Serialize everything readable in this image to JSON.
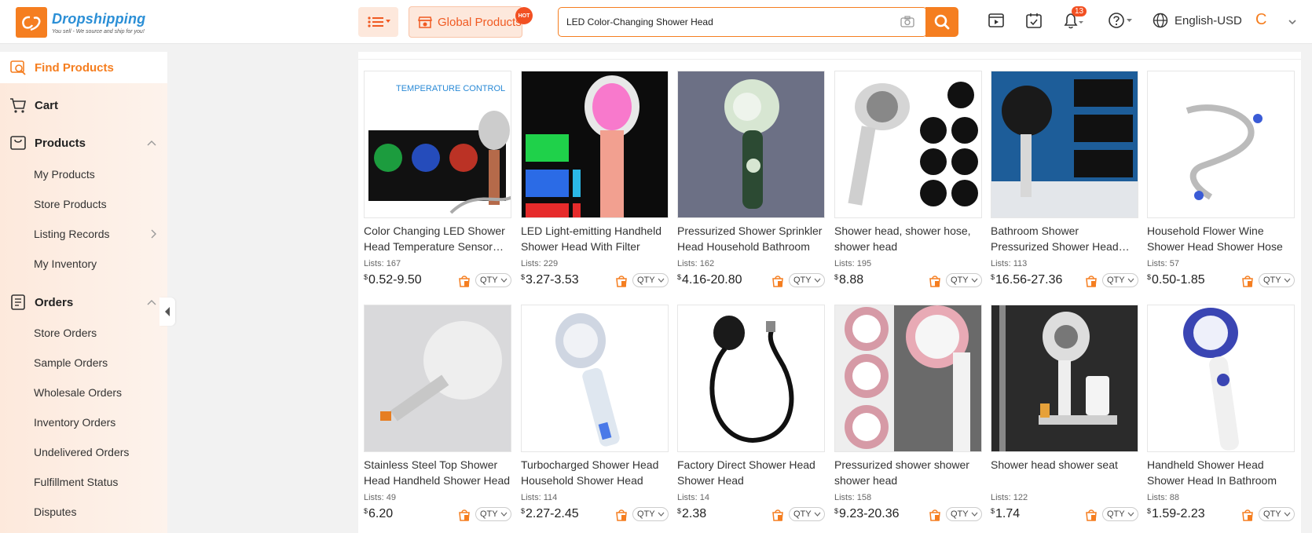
{
  "header": {
    "logo_title": "Dropshipping",
    "logo_sub": "You sell - We source and ship for you!",
    "global_label": "Global Products",
    "hot_badge": "HOT",
    "search_value": "LED Color-Changing Shower Head",
    "notification_count": "13",
    "language": "English-USD",
    "avatar_initial": "C"
  },
  "colors": {
    "accent": "#f57e20",
    "link": "#2b8fd6",
    "badge": "#f25022"
  },
  "sidebar": {
    "find_products": "Find Products",
    "cart": "Cart",
    "products": "Products",
    "products_items": [
      "My Products",
      "Store Products",
      "Listing Records",
      "My Inventory"
    ],
    "orders": "Orders",
    "orders_items": [
      "Store Orders",
      "Sample Orders",
      "Wholesale Orders",
      "Inventory Orders",
      "Undelivered Orders",
      "Fulfillment Status",
      "Disputes"
    ]
  },
  "products": [
    {
      "title": "Color Changing LED Shower Head Temperature Sensor Handheld",
      "lists": "Lists: 167",
      "price": "0.52-9.50"
    },
    {
      "title": "LED Light-emitting Handheld Shower Head With Filter",
      "lists": "Lists: 229",
      "price": "3.27-3.53"
    },
    {
      "title": "Pressurized Shower Sprinkler Head Household Bathroom",
      "lists": "Lists: 162",
      "price": "4.16-20.80"
    },
    {
      "title": "Shower head, shower hose, shower head",
      "lists": "Lists: 195",
      "price": "8.88"
    },
    {
      "title": "Bathroom Shower Pressurized Shower Head Filter",
      "lists": "Lists: 113",
      "price": "16.56-27.36"
    },
    {
      "title": "Household Flower Wine Shower Head Shower Hose",
      "lists": "Lists: 57",
      "price": "0.50-1.85"
    },
    {
      "title": "Stainless Steel Top Shower Head Handheld Shower Head",
      "lists": "Lists: 49",
      "price": "6.20"
    },
    {
      "title": "Turbocharged Shower Head Household Shower Head",
      "lists": "Lists: 114",
      "price": "2.27-2.45"
    },
    {
      "title": "Factory Direct Shower Head Shower Head",
      "lists": "Lists: 14",
      "price": "2.38"
    },
    {
      "title": "Pressurized shower shower shower head",
      "lists": "Lists: 158",
      "price": "9.23-20.36"
    },
    {
      "title": "Shower head shower seat",
      "lists": "Lists: 122",
      "price": "1.74"
    },
    {
      "title": "Handheld Shower Head Shower Head In Bathroom",
      "lists": "Lists: 88",
      "price": "1.59-2.23"
    }
  ],
  "currency": "$",
  "qty_label": "QTY"
}
